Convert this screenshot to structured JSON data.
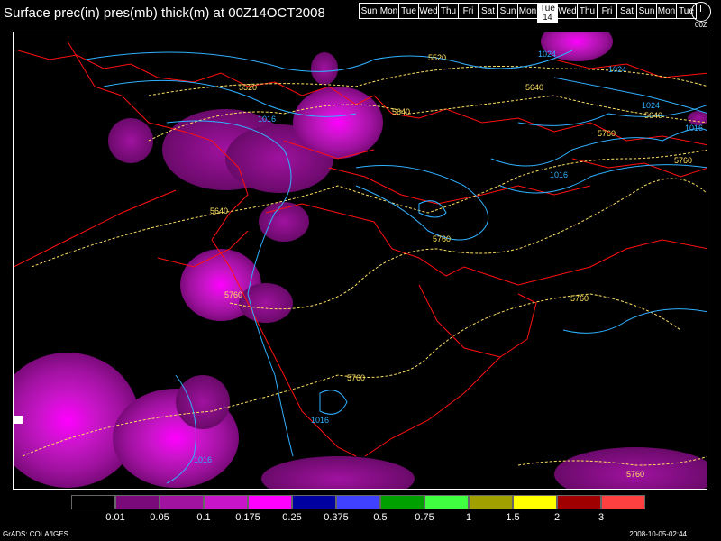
{
  "title": "Surface prec(in) pres(mb) thick(m) at 00Z14OCT2008",
  "timeline": [
    {
      "label": "Sun"
    },
    {
      "label": "Mon"
    },
    {
      "label": "Tue"
    },
    {
      "label": "Wed"
    },
    {
      "label": "Thu"
    },
    {
      "label": "Fri"
    },
    {
      "label": "Sat"
    },
    {
      "label": "Sun"
    },
    {
      "label": "Mon"
    },
    {
      "label": "Tue",
      "num": "14",
      "selected": true
    },
    {
      "label": "Wed"
    },
    {
      "label": "Thu"
    },
    {
      "label": "Fri"
    },
    {
      "label": "Sat"
    },
    {
      "label": "Sun"
    },
    {
      "label": "Mon"
    },
    {
      "label": "Tue"
    }
  ],
  "clock_label": "00Z",
  "map_labels": {
    "thickness": [
      "5520",
      "5520",
      "5640",
      "5640",
      "5640",
      "5640",
      "5760",
      "5760",
      "5760",
      "5760",
      "5760",
      "5760",
      "5760"
    ],
    "pressure": [
      "1024",
      "1024",
      "1024",
      "1016",
      "1016",
      "1016",
      "1016",
      "1016"
    ]
  },
  "legend": {
    "colors": [
      "#000000",
      "#7a0a7a",
      "#a012a0",
      "#c815c8",
      "#ff00ff",
      "#0000a0",
      "#4040ff",
      "#00a000",
      "#40ff40",
      "#a0a000",
      "#ffff00",
      "#a00000",
      "#ff4040"
    ],
    "labels": [
      "0.01",
      "0.05",
      "0.1",
      "0.175",
      "0.25",
      "0.375",
      "0.5",
      "0.75",
      "1",
      "1.5",
      "2",
      "3"
    ]
  },
  "footer": {
    "left": "GrADS: COLA/IGES",
    "right": "2008-10-05-02:44"
  }
}
